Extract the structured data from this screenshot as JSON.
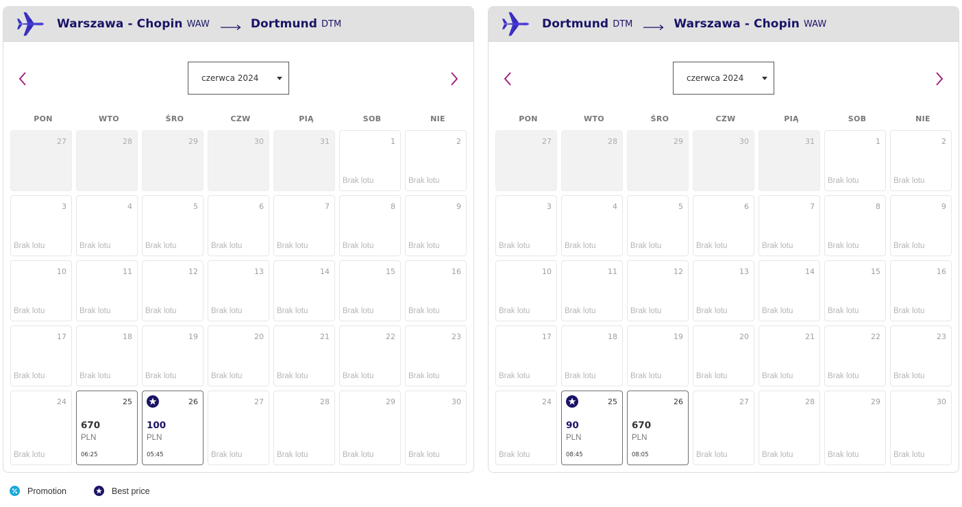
{
  "weekdays": [
    "PON",
    "WTO",
    "ŚRO",
    "CZW",
    "PIĄ",
    "SOB",
    "NIE"
  ],
  "colors": {
    "brand_navy": "#1a1466",
    "plane_purple": "#3f36c9",
    "nav_arrow": "#a0237f",
    "promotion": "#1aa7d8"
  },
  "no_flight_label": "Brak lotu",
  "panels": [
    {
      "origin_city": "Warszawa - Chopin",
      "origin_code": "WAW",
      "dest_city": "Dortmund",
      "dest_code": "DTM",
      "month": "czerwca 2024",
      "prev_icon": "chevron-left-icon",
      "next_icon": "chevron-right-icon",
      "days": [
        {
          "day": "27",
          "state": "disabled"
        },
        {
          "day": "28",
          "state": "disabled"
        },
        {
          "day": "29",
          "state": "disabled"
        },
        {
          "day": "30",
          "state": "disabled"
        },
        {
          "day": "31",
          "state": "disabled"
        },
        {
          "day": "1",
          "state": "none"
        },
        {
          "day": "2",
          "state": "none"
        },
        {
          "day": "3",
          "state": "none"
        },
        {
          "day": "4",
          "state": "none"
        },
        {
          "day": "5",
          "state": "none"
        },
        {
          "day": "6",
          "state": "none"
        },
        {
          "day": "7",
          "state": "none"
        },
        {
          "day": "8",
          "state": "none"
        },
        {
          "day": "9",
          "state": "none"
        },
        {
          "day": "10",
          "state": "none"
        },
        {
          "day": "11",
          "state": "none"
        },
        {
          "day": "12",
          "state": "none"
        },
        {
          "day": "13",
          "state": "none"
        },
        {
          "day": "14",
          "state": "none"
        },
        {
          "day": "15",
          "state": "none"
        },
        {
          "day": "16",
          "state": "none"
        },
        {
          "day": "17",
          "state": "none"
        },
        {
          "day": "18",
          "state": "none"
        },
        {
          "day": "19",
          "state": "none"
        },
        {
          "day": "20",
          "state": "none"
        },
        {
          "day": "21",
          "state": "none"
        },
        {
          "day": "22",
          "state": "none"
        },
        {
          "day": "23",
          "state": "none"
        },
        {
          "day": "24",
          "state": "none"
        },
        {
          "day": "25",
          "state": "priced",
          "price": "670",
          "currency": "PLN",
          "time": "06:25",
          "best": false
        },
        {
          "day": "26",
          "state": "priced",
          "price": "100",
          "currency": "PLN",
          "time": "05:45",
          "best": true
        },
        {
          "day": "27",
          "state": "none"
        },
        {
          "day": "28",
          "state": "none"
        },
        {
          "day": "29",
          "state": "none"
        },
        {
          "day": "30",
          "state": "none"
        }
      ]
    },
    {
      "origin_city": "Dortmund",
      "origin_code": "DTM",
      "dest_city": "Warszawa - Chopin",
      "dest_code": "WAW",
      "month": "czerwca 2024",
      "prev_icon": "chevron-left-icon",
      "next_icon": "chevron-right-icon",
      "days": [
        {
          "day": "27",
          "state": "disabled"
        },
        {
          "day": "28",
          "state": "disabled"
        },
        {
          "day": "29",
          "state": "disabled"
        },
        {
          "day": "30",
          "state": "disabled"
        },
        {
          "day": "31",
          "state": "disabled"
        },
        {
          "day": "1",
          "state": "none"
        },
        {
          "day": "2",
          "state": "none"
        },
        {
          "day": "3",
          "state": "none"
        },
        {
          "day": "4",
          "state": "none"
        },
        {
          "day": "5",
          "state": "none"
        },
        {
          "day": "6",
          "state": "none"
        },
        {
          "day": "7",
          "state": "none"
        },
        {
          "day": "8",
          "state": "none"
        },
        {
          "day": "9",
          "state": "none"
        },
        {
          "day": "10",
          "state": "none"
        },
        {
          "day": "11",
          "state": "none"
        },
        {
          "day": "12",
          "state": "none"
        },
        {
          "day": "13",
          "state": "none"
        },
        {
          "day": "14",
          "state": "none"
        },
        {
          "day": "15",
          "state": "none"
        },
        {
          "day": "16",
          "state": "none"
        },
        {
          "day": "17",
          "state": "none"
        },
        {
          "day": "18",
          "state": "none"
        },
        {
          "day": "19",
          "state": "none"
        },
        {
          "day": "20",
          "state": "none"
        },
        {
          "day": "21",
          "state": "none"
        },
        {
          "day": "22",
          "state": "none"
        },
        {
          "day": "23",
          "state": "none"
        },
        {
          "day": "24",
          "state": "none"
        },
        {
          "day": "25",
          "state": "priced",
          "price": "90",
          "currency": "PLN",
          "time": "08:45",
          "best": true
        },
        {
          "day": "26",
          "state": "priced",
          "price": "670",
          "currency": "PLN",
          "time": "08:05",
          "best": false
        },
        {
          "day": "27",
          "state": "none"
        },
        {
          "day": "28",
          "state": "none"
        },
        {
          "day": "29",
          "state": "none"
        },
        {
          "day": "30",
          "state": "none"
        }
      ]
    }
  ],
  "legend": {
    "promotion_label": "Promotion",
    "promotion_icon": "percent-badge-icon",
    "best_price_label": "Best price",
    "best_price_icon": "star-badge-icon"
  }
}
